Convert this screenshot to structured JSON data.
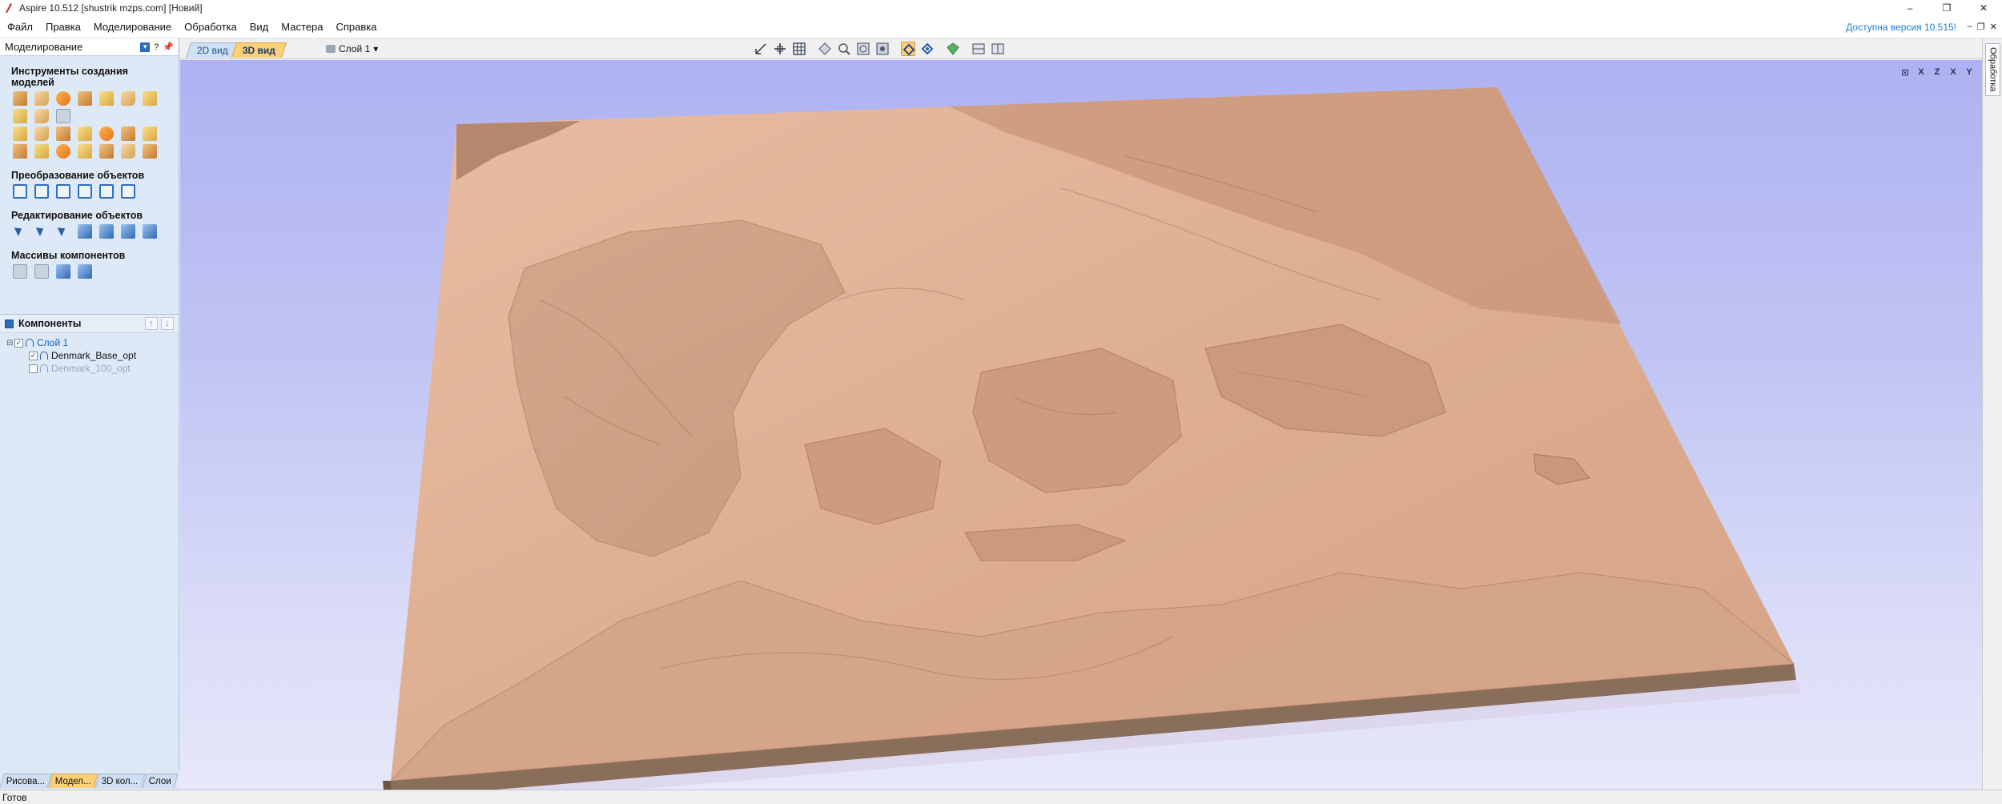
{
  "window": {
    "title": "Aspire 10.512   [shustrik mzps.com]   [Новий]",
    "icon": "aspire-logo-icon"
  },
  "menu": {
    "items": [
      "Файл",
      "Правка",
      "Моделирование",
      "Обработка",
      "Вид",
      "Мастера",
      "Справка"
    ],
    "update_notice": "Доступна версия 10.515!"
  },
  "left_panel": {
    "title": "Моделирование",
    "help": "?",
    "sections": {
      "create": "Инструменты создания моделей",
      "transform": "Преобразование объектов",
      "edit": "Редактирование объектов",
      "arrays": "Массивы компонентов"
    },
    "components": {
      "title": "Компоненты",
      "layer": "Слой 1",
      "items": [
        {
          "name": "Denmark_Base_opt",
          "checked": true
        },
        {
          "name": "Denmark_100_opt",
          "checked": false
        }
      ]
    },
    "bottom_tabs": [
      "Рисова...",
      "Модел...",
      "3D кол...",
      "Слои"
    ],
    "active_tab": "Модел..."
  },
  "view": {
    "tab_2d": "2D вид",
    "tab_3d": "3D вид",
    "layer_select": "Слой 1",
    "corner_icons": [
      "zoom-extents-icon",
      "X",
      "Z",
      "X",
      "Y"
    ]
  },
  "right_tab": "Обработка",
  "status": "Готов",
  "colors": {
    "accent_tab": "#fbd077",
    "panel_bg": "#dde9f6",
    "model_top": "#deac8f",
    "model_side": "#8a6e5c",
    "link": "#1c7cd6"
  }
}
